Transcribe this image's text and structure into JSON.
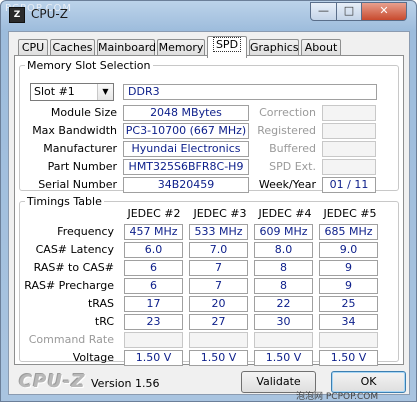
{
  "window": {
    "title": "CPU-Z",
    "watermark": "PCPOP.COM",
    "icon_label": "Z",
    "controls": {
      "minimize": "—",
      "maximize": "□",
      "close": "✕"
    }
  },
  "tabs": [
    {
      "label": "CPU",
      "active": false
    },
    {
      "label": "Caches",
      "active": false
    },
    {
      "label": "Mainboard",
      "active": false
    },
    {
      "label": "Memory",
      "active": false
    },
    {
      "label": "SPD",
      "active": true
    },
    {
      "label": "Graphics",
      "active": false
    },
    {
      "label": "About",
      "active": false
    }
  ],
  "memory_slot": {
    "legend": "Memory Slot Selection",
    "slot_selected": "Slot #1",
    "type": "DDR3",
    "fields": {
      "module_size": {
        "label": "Module Size",
        "value": "2048 MBytes"
      },
      "max_bandwidth": {
        "label": "Max Bandwidth",
        "value": "PC3-10700 (667 MHz)"
      },
      "manufacturer": {
        "label": "Manufacturer",
        "value": "Hyundai Electronics"
      },
      "part_number": {
        "label": "Part Number",
        "value": "HMT325S6BFR8C-H9"
      },
      "serial_number": {
        "label": "Serial Number",
        "value": "34B20459"
      }
    },
    "right_fields": {
      "correction": {
        "label": "Correction",
        "value": ""
      },
      "registered": {
        "label": "Registered",
        "value": ""
      },
      "buffered": {
        "label": "Buffered",
        "value": ""
      },
      "spd_ext": {
        "label": "SPD Ext.",
        "value": ""
      },
      "week_year": {
        "label": "Week/Year",
        "value": "01 / 11"
      }
    }
  },
  "timings": {
    "legend": "Timings Table",
    "columns": [
      "JEDEC #2",
      "JEDEC #3",
      "JEDEC #4",
      "JEDEC #5"
    ],
    "rows": [
      {
        "label": "Frequency",
        "dim": false,
        "values": [
          "457 MHz",
          "533 MHz",
          "609 MHz",
          "685 MHz"
        ]
      },
      {
        "label": "CAS# Latency",
        "dim": false,
        "values": [
          "6.0",
          "7.0",
          "8.0",
          "9.0"
        ]
      },
      {
        "label": "RAS# to CAS#",
        "dim": false,
        "values": [
          "6",
          "7",
          "8",
          "9"
        ]
      },
      {
        "label": "RAS# Precharge",
        "dim": false,
        "values": [
          "6",
          "7",
          "8",
          "9"
        ]
      },
      {
        "label": "tRAS",
        "dim": false,
        "values": [
          "17",
          "20",
          "22",
          "25"
        ]
      },
      {
        "label": "tRC",
        "dim": false,
        "values": [
          "23",
          "27",
          "30",
          "34"
        ]
      },
      {
        "label": "Command Rate",
        "dim": true,
        "values": [
          "",
          "",
          "",
          ""
        ]
      },
      {
        "label": "Voltage",
        "dim": false,
        "values": [
          "1.50 V",
          "1.50 V",
          "1.50 V",
          "1.50 V"
        ]
      }
    ]
  },
  "footer": {
    "logo": "CPU-Z",
    "version": "Version 1.56",
    "validate_label": "Validate",
    "ok_label": "OK",
    "site_mark": "泡泡网 PCPOP.COM"
  },
  "colors": {
    "value_text": "#0c1e8a",
    "title_bar": "#a9c4e0"
  }
}
